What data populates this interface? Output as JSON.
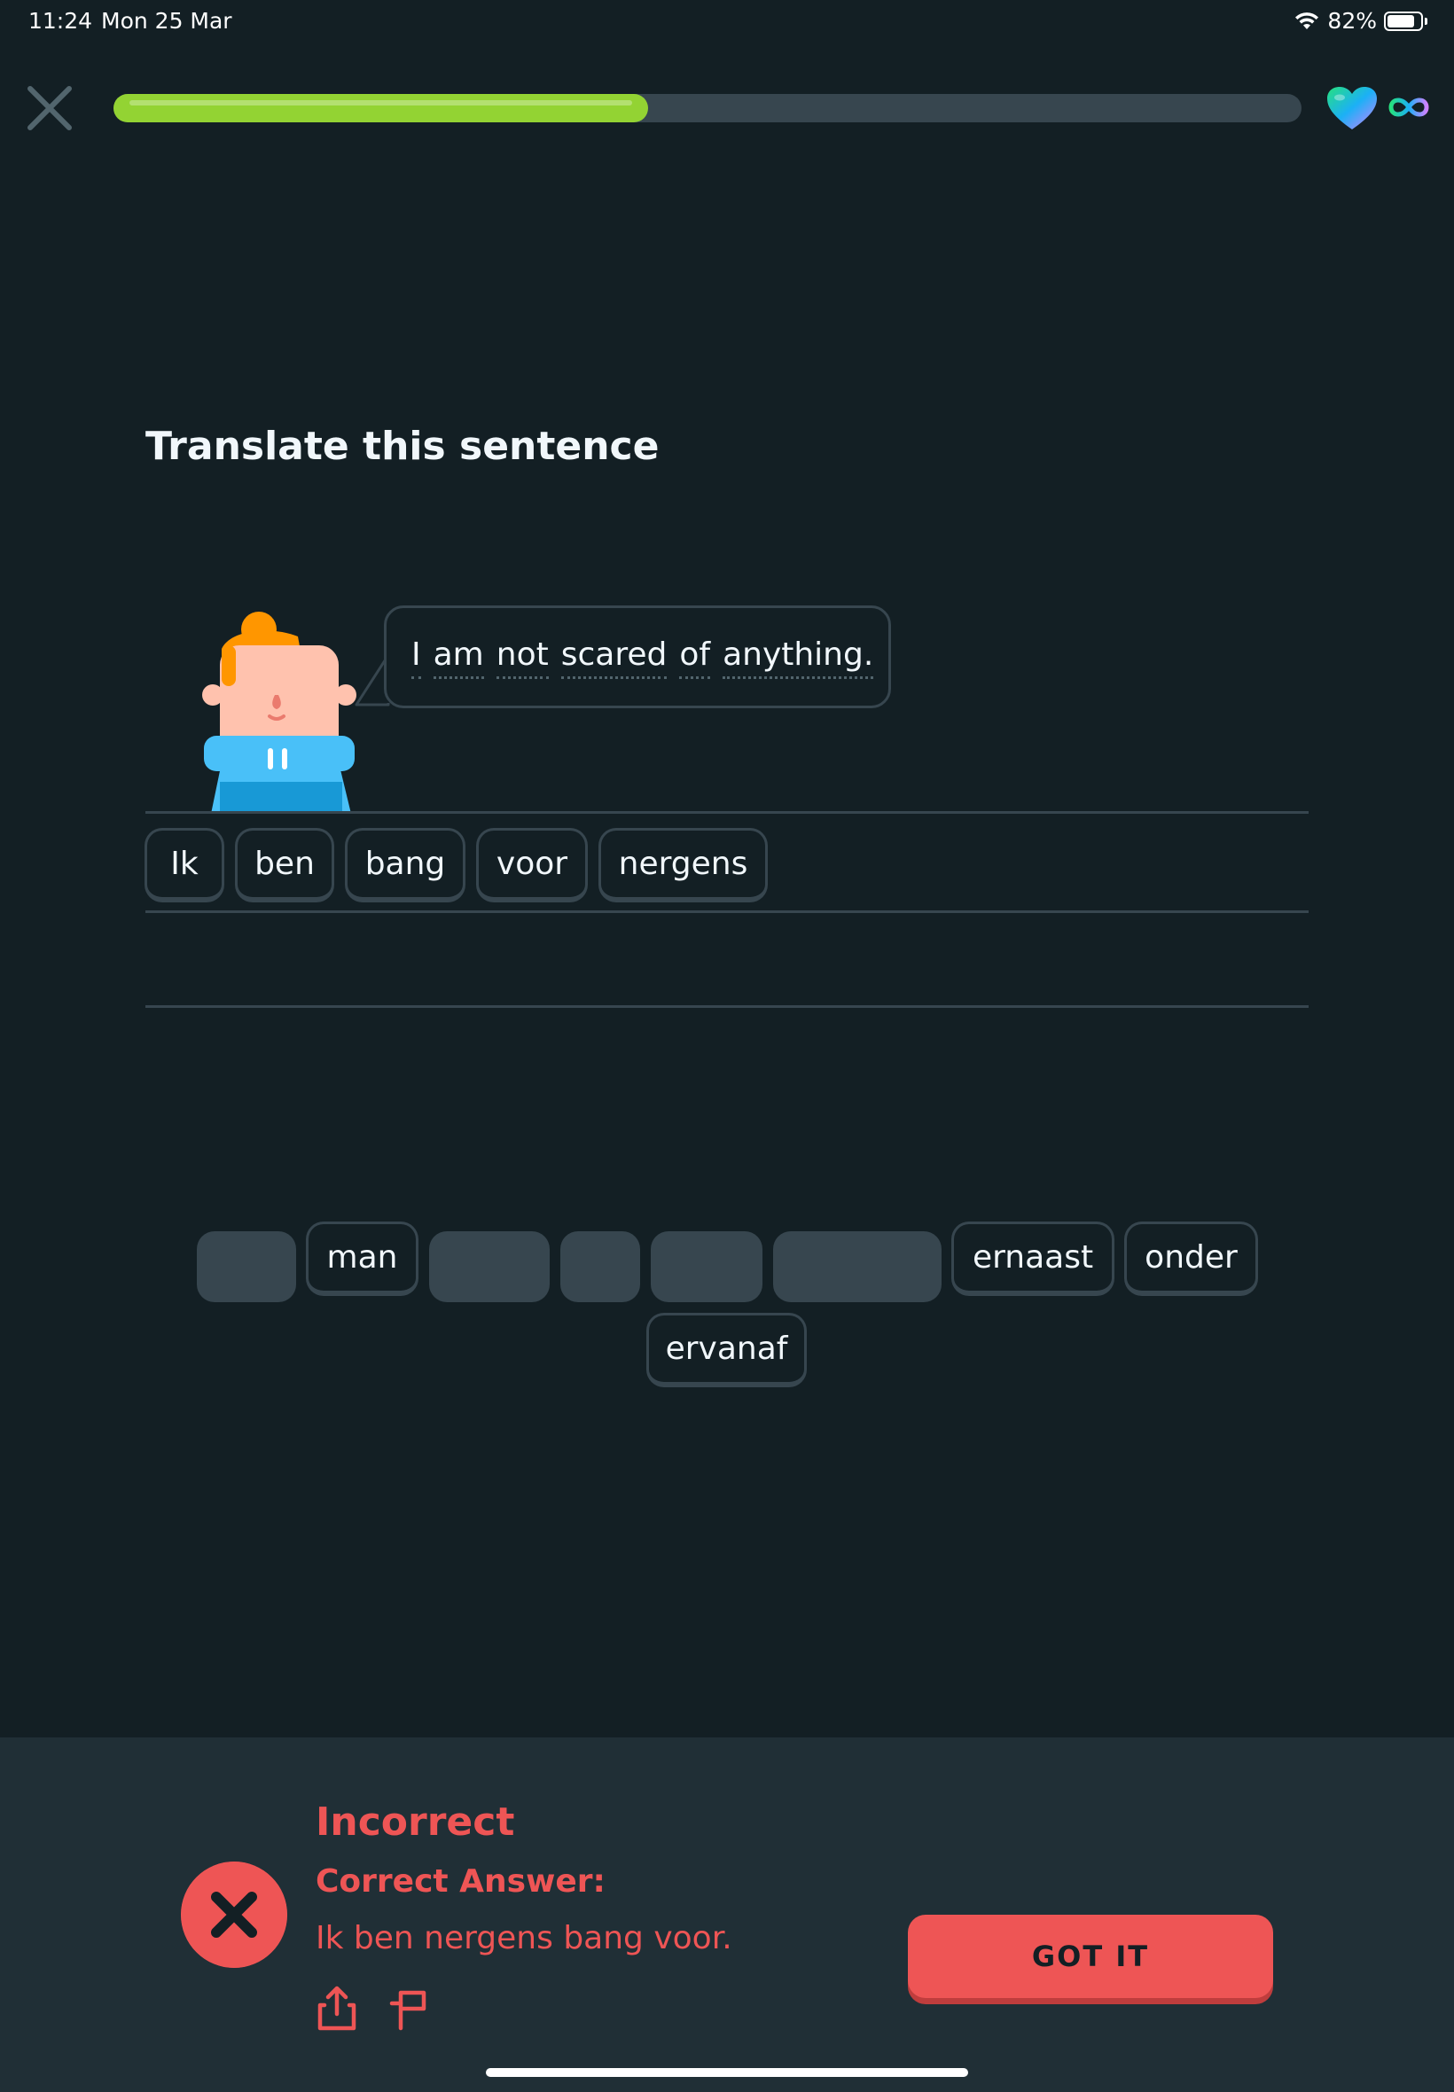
{
  "status_bar": {
    "time": "11:24",
    "date": "Mon 25 Mar",
    "battery": "82%",
    "battery_level": 0.82
  },
  "header": {
    "close_icon": "close-icon",
    "progress": 0.45,
    "hearts_icon": "heart-icon",
    "hearts_value_icon": "infinity-icon"
  },
  "prompt": {
    "title": "Translate this sentence",
    "sentence_words": [
      "I",
      "am",
      "not",
      "scared",
      "of",
      "anything."
    ]
  },
  "answer_tiles": [
    "Ik",
    "ben",
    "bang",
    "voor",
    "nergens"
  ],
  "word_bank": {
    "row1": [
      {
        "label": "",
        "used": true
      },
      {
        "label": "man",
        "used": false
      },
      {
        "label": "",
        "used": true
      },
      {
        "label": "",
        "used": true
      },
      {
        "label": "",
        "used": true
      },
      {
        "label": "",
        "used": true
      },
      {
        "label": "ernaast",
        "used": false
      },
      {
        "label": "onder",
        "used": false
      }
    ],
    "row2": [
      {
        "label": "ervanaf",
        "used": false
      }
    ]
  },
  "feedback": {
    "title": "Incorrect",
    "subtitle": "Correct Answer:",
    "answer": "Ik ben nergens bang voor.",
    "button": "GOT IT",
    "colors": {
      "error": "#ee5555",
      "panel": "#202f36",
      "background": "#131f24",
      "progress": "#93d333"
    }
  }
}
